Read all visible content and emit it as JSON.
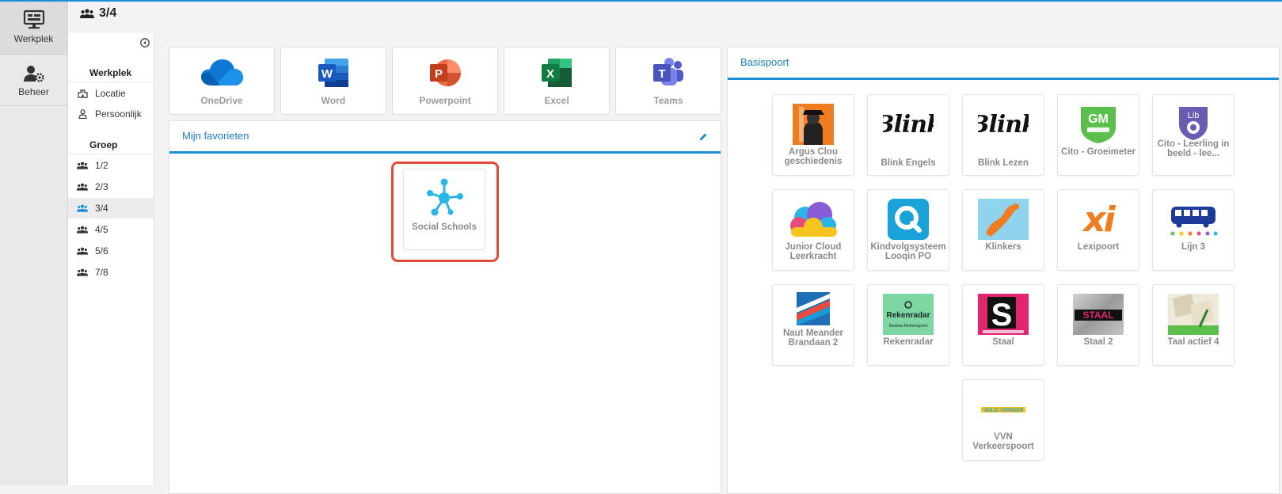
{
  "rail": {
    "items": [
      {
        "label": "Werkplek",
        "icon": "monitor-icon"
      },
      {
        "label": "Beheer",
        "icon": "user-gear-icon"
      }
    ]
  },
  "topbar": {
    "group": "3/4"
  },
  "sidebar": {
    "werkplek_title": "Werkplek",
    "werkplek_items": [
      {
        "label": "Locatie",
        "icon": "building-icon"
      },
      {
        "label": "Persoonlijk",
        "icon": "person-icon"
      }
    ],
    "groep_title": "Groep",
    "groep_items": [
      {
        "label": "1/2"
      },
      {
        "label": "2/3"
      },
      {
        "label": "3/4"
      },
      {
        "label": "4/5"
      },
      {
        "label": "5/6"
      },
      {
        "label": "7/8"
      }
    ]
  },
  "apps": [
    {
      "label": "OneDrive",
      "icon": "onedrive-icon"
    },
    {
      "label": "Word",
      "icon": "word-icon"
    },
    {
      "label": "Powerpoint",
      "icon": "powerpoint-icon"
    },
    {
      "label": "Excel",
      "icon": "excel-icon"
    },
    {
      "label": "Teams",
      "icon": "teams-icon"
    }
  ],
  "favorites": {
    "title": "Mijn favorieten",
    "items": [
      {
        "label": "Social Schools",
        "icon": "social-schools-icon"
      }
    ]
  },
  "basispoort": {
    "title": "Basispoort",
    "tiles": [
      {
        "label": "Argus Clou geschiedenis"
      },
      {
        "label": "Blink Engels",
        "logo_text": "Blink"
      },
      {
        "label": "Blink Lezen",
        "logo_text": "Blink"
      },
      {
        "label": "Cito - Groeimeter",
        "logo_text": "GM"
      },
      {
        "label": "Cito - Leerling in beeld - lee...",
        "logo_text": "Lib"
      },
      {
        "label": "Junior Cloud Leerkracht"
      },
      {
        "label": "Kindvolgsysteem Looqin PO"
      },
      {
        "label": "Klinkers"
      },
      {
        "label": "Lexipoort",
        "logo_text": "xi"
      },
      {
        "label": "Lijn 3"
      },
      {
        "label": "Naut Meander Brandaan 2"
      },
      {
        "label": "Rekenradar",
        "logo_text": "Rekenradar",
        "logo_subtext": "Bareka Rekensprint"
      },
      {
        "label": "Staal",
        "logo_text": "S"
      },
      {
        "label": "Staal 2",
        "logo_text": "STAAL"
      },
      {
        "label": "Taal actief 4"
      },
      {
        "label": "VVN Verkeerspoort",
        "logo_text": "VEILIG VERKEER"
      }
    ]
  },
  "colors": {
    "accent": "#1b8fd6",
    "highlight": "#e24b3c"
  }
}
